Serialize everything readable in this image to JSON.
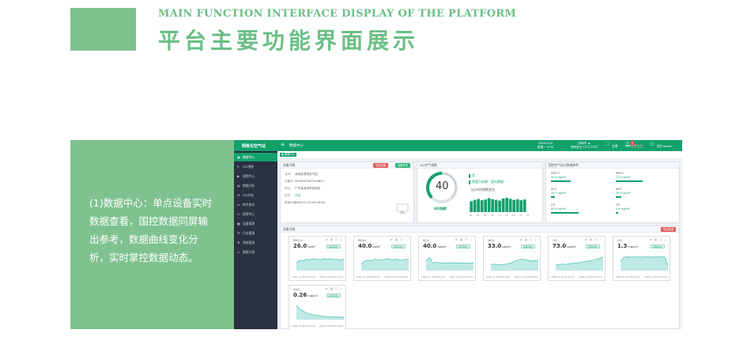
{
  "banner": {
    "en_title": "MAIN FUNCTION INTERFACE DISPLAY OF THE PLATFORM",
    "zh_title": "平台主要功能界面展示"
  },
  "description": "(1)数据中心：单点设备实时数据查看，国控数据同屏输出参考，数据曲线变化分析，实时掌控数据动态。",
  "app": {
    "logo": "网格化空气站",
    "breadcrumb": "数据中心",
    "date_line1": "2020/11/9",
    "date_line2": "星期一 9:30",
    "weather_line1": "深圳市 ☁",
    "weather_line2": "晴转多云 15℃-25℃",
    "fullscreen_label": "全屏",
    "alarm_label": "报警信息",
    "alarm_count": "9",
    "user_label": "用户admin",
    "sidebar": [
      {
        "label": "数据中心",
        "icon": "grid-icon"
      },
      {
        "label": "GIS地图",
        "icon": "map-icon"
      },
      {
        "label": "视频中心",
        "icon": "video-icon"
      },
      {
        "label": "数据分析",
        "icon": "chart-icon"
      },
      {
        "label": "AQI分析",
        "icon": "gauge-icon"
      },
      {
        "label": "综合排名",
        "icon": "rank-icon"
      },
      {
        "label": "报警中心",
        "icon": "bell-icon"
      },
      {
        "label": "设备管理",
        "icon": "device-icon"
      },
      {
        "label": "日志管理",
        "icon": "log-icon"
      },
      {
        "label": "系统管理",
        "icon": "gear-icon"
      },
      {
        "label": "数据大屏",
        "icon": "screen-icon"
      }
    ],
    "tab_chip": "● 数据中心",
    "device_card": {
      "title": "设备详情",
      "btn_left": "切换设备",
      "btn_right": "设备详情",
      "rows": [
        {
          "k": "名称:",
          "v": "龙岗区观测空气站"
        },
        {
          "k": "设备号:",
          "v": "20200410ET10ABC7"
        },
        {
          "k": "地址:",
          "v": "广东省深圳市龙岗区"
        },
        {
          "k": "状态:",
          "v": "在线"
        },
        {
          "k": "更新时间:",
          "v": "2020-11-09 09:16:04"
        }
      ]
    },
    "aqi_card": {
      "title": "AQI空气指数",
      "value": "40",
      "label": "AQI指数",
      "level": "优",
      "primary": "首要污染物：暂无数据",
      "trend_title": "当日AQI指数变化",
      "times": [
        "00",
        "03",
        "06",
        "09",
        "12",
        "15",
        "18",
        "21",
        "24"
      ],
      "bars": [
        0.62,
        0.7,
        0.75,
        0.68,
        0.72,
        0.8,
        0.74,
        0.7,
        0.66,
        0.78,
        0.82,
        0.76,
        0.7,
        0.74,
        0.68,
        0.72
      ]
    },
    "pollutant_card": {
      "title": "国控空气站点数据参考",
      "items": [
        {
          "name": "PM2.5",
          "value": "30.0 ug/m³",
          "level": 0.5
        },
        {
          "name": "PM10",
          "value": "72.0 ug/m³",
          "level": 0.68
        },
        {
          "name": "SO2",
          "value": "15.0 ug/m³",
          "level": 0.1
        },
        {
          "name": "NO2",
          "value": "38.0 ug/m³",
          "level": 0.14
        },
        {
          "name": "CO",
          "value": "60.0 ug/m³",
          "level": 0.7
        },
        {
          "name": "O3",
          "value": "0.6 mg/m³",
          "level": 0.06
        }
      ]
    },
    "monitor": {
      "title": "设备详情",
      "btn_export": "导出数据",
      "tag_label": "实时对比",
      "time_start": "2020-11-09 09:23:04",
      "time_end": "2020-11-09 09:53:04",
      "cards": [
        {
          "name": "PM2.5",
          "value": "26.0",
          "unit": "ug/m³",
          "series": [
            0.4,
            0.55,
            0.52,
            0.6,
            0.58,
            0.62,
            0.6,
            0.57,
            0.63,
            0.6,
            0.62,
            0.58,
            0.6,
            0.56,
            0.6
          ]
        },
        {
          "name": "PM10",
          "value": "40.0",
          "unit": "ug/m³",
          "series": [
            0.35,
            0.5,
            0.55,
            0.52,
            0.6,
            0.58,
            0.55,
            0.6,
            0.62,
            0.57,
            0.6,
            0.58,
            0.55,
            0.6,
            0.58
          ]
        },
        {
          "name": "SO2",
          "value": "40.0",
          "unit": "ug/m3",
          "series": [
            0.5,
            0.7,
            0.4,
            0.45,
            0.4,
            0.42,
            0.38,
            0.4,
            0.42,
            0.39,
            0.4,
            0.41,
            0.38,
            0.4,
            0.39
          ]
        },
        {
          "name": "NO2",
          "value": "33.0",
          "unit": "ug/m3",
          "series": [
            0.3,
            0.35,
            0.32,
            0.3,
            0.33,
            0.36,
            0.4,
            0.5,
            0.55,
            0.6,
            0.58,
            0.55,
            0.5,
            0.52,
            0.55
          ]
        },
        {
          "name": "O3",
          "value": "73.0",
          "unit": "ug/m3",
          "series": [
            0.3,
            0.32,
            0.35,
            0.33,
            0.36,
            0.38,
            0.4,
            0.42,
            0.45,
            0.48,
            0.52,
            0.55,
            0.6,
            0.65,
            0.72
          ]
        },
        {
          "name": "CO",
          "value": "1.3",
          "unit": "mg/m3",
          "series": [
            0.5,
            0.7,
            0.72,
            0.71,
            0.72,
            0.72,
            0.71,
            0.72,
            0.72,
            0.71,
            0.72,
            0.72,
            0.72,
            0.71,
            0.3
          ]
        },
        {
          "name": "VOC",
          "value": "0.26",
          "unit": "mg/m3",
          "series": [
            0.75,
            0.55,
            0.45,
            0.35,
            0.3,
            0.25,
            0.22,
            0.2,
            0.18,
            0.16,
            0.15,
            0.14,
            0.14,
            0.13,
            0.13
          ]
        }
      ]
    }
  }
}
